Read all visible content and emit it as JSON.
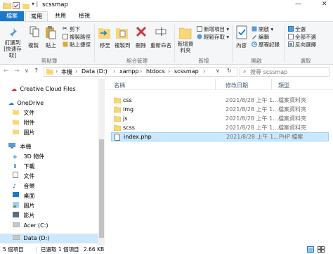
{
  "window": {
    "title": "scssmap",
    "minimize": "—",
    "close": "✕"
  },
  "tabs": [
    {
      "label": "檔案"
    },
    {
      "label": "常用"
    },
    {
      "label": "共用"
    },
    {
      "label": "檢視"
    }
  ],
  "ribbon": {
    "pin_quick": "釘選到[快速存取]",
    "copy": "複製",
    "paste": "貼上",
    "cut": "剪下",
    "copy_path": "複製路徑",
    "paste_shortcut": "貼上捷徑",
    "group_clipboard": "剪貼簿",
    "move_to": "移至",
    "copy_to": "複製到",
    "delete": "刪除",
    "rename": "重新命名",
    "group_organize": "組合管理",
    "new_folder": "新增資料夾",
    "new_item": "新增項目 ▾",
    "easy_access": "輕鬆存取 ▾",
    "group_new": "新增",
    "properties": "內容",
    "open": "開啟 ▾",
    "edit": "編輯",
    "history": "歷程記錄",
    "group_open": "開啟",
    "select_all": "全選",
    "select_none": "全部不選",
    "invert_selection": "反向選擇",
    "group_select": "選取"
  },
  "address": {
    "path": [
      "本機",
      "Data (D:)",
      "xampp",
      "htdocs",
      "scssmap"
    ],
    "search_placeholder": "搜尋 scssmap"
  },
  "nav": {
    "items": [
      {
        "label": "Creative Cloud Files",
        "icon": "creative-cloud-icon"
      },
      {
        "label": "OneDrive",
        "icon": "onedrive-icon"
      },
      {
        "label": "文件",
        "icon": "folder-icon"
      },
      {
        "label": "附件",
        "icon": "folder-icon"
      },
      {
        "label": "圖片",
        "icon": "folder-icon"
      },
      {
        "label": "本機",
        "icon": "pc-icon"
      },
      {
        "label": "3D 物件",
        "icon": "3d-objects-icon"
      },
      {
        "label": "下載",
        "icon": "download-icon"
      },
      {
        "label": "文件",
        "icon": "documents-icon"
      },
      {
        "label": "音樂",
        "icon": "music-icon"
      },
      {
        "label": "桌面",
        "icon": "desktop-icon"
      },
      {
        "label": "圖片",
        "icon": "pictures-icon"
      },
      {
        "label": "影片",
        "icon": "videos-icon"
      },
      {
        "label": "Acer (C:)",
        "icon": "drive-icon"
      },
      {
        "label": "Data (D:)",
        "icon": "drive-icon"
      }
    ]
  },
  "columns": {
    "name": "名稱",
    "date": "修改日期",
    "type": "類型"
  },
  "files": [
    {
      "name": "css",
      "date": "2021/8/28 上午 1...",
      "type": "檔案資料夾",
      "kind": "folder"
    },
    {
      "name": "img",
      "date": "2021/8/28 上午 1...",
      "type": "檔案資料夾",
      "kind": "folder"
    },
    {
      "name": "js",
      "date": "2021/8/28 上午 1...",
      "type": "檔案資料夾",
      "kind": "folder"
    },
    {
      "name": "scss",
      "date": "2021/8/28 上午 1...",
      "type": "檔案資料夾",
      "kind": "folder"
    },
    {
      "name": "index.php",
      "date": "2021/8/28 上午 1...",
      "type": "PHP 檔案",
      "kind": "file"
    }
  ],
  "status": {
    "count": "5 個項目",
    "selected": "已選取 1 個項目",
    "size": "2.66 KB"
  },
  "colors": {
    "accent": "#1979ca",
    "folder": "#f8d775",
    "selected_row": "#cce8ff"
  }
}
